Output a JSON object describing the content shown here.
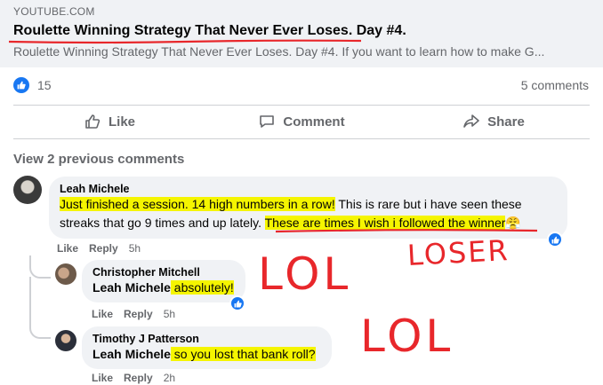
{
  "link_preview": {
    "source": "YOUTUBE.COM",
    "title": "Roulette Winning Strategy That Never Ever Loses. Day #4.",
    "description": "Roulette Winning Strategy That Never Ever Loses. Day #4. If you want to learn how to make G..."
  },
  "stats": {
    "reaction_count": "15",
    "comments_count": "5 comments"
  },
  "actions": {
    "like": "Like",
    "comment": "Comment",
    "share": "Share"
  },
  "view_previous": "View 2 previous comments",
  "comments": [
    {
      "author": "Leah Michele",
      "text_hl1": "Just finished a session. 14 high numbers in a row!",
      "text_mid": " This is rare but i have seen these streaks that go 9 times and up lately. ",
      "text_hl2": "These are times I wish i followed the winner",
      "emoji": "😤",
      "like": "Like",
      "reply": "Reply",
      "time": "5h"
    },
    {
      "author": "Christopher Mitchell",
      "mention": "Leah Michele",
      "text": " absolutely!",
      "like": "Like",
      "reply": "Reply",
      "time": "5h"
    },
    {
      "author": "Timothy J Patterson",
      "mention": "Leah Michele",
      "text": " so you lost that bank roll?",
      "like": "Like",
      "reply": "Reply",
      "time": "2h"
    }
  ],
  "annotations": {
    "loser": "LOSER",
    "lol1": "LOL",
    "lol2": "LOL"
  },
  "colors": {
    "facebook_blue": "#1877f2",
    "highlight": "#f5f500",
    "annotation_red": "#e8272b"
  }
}
